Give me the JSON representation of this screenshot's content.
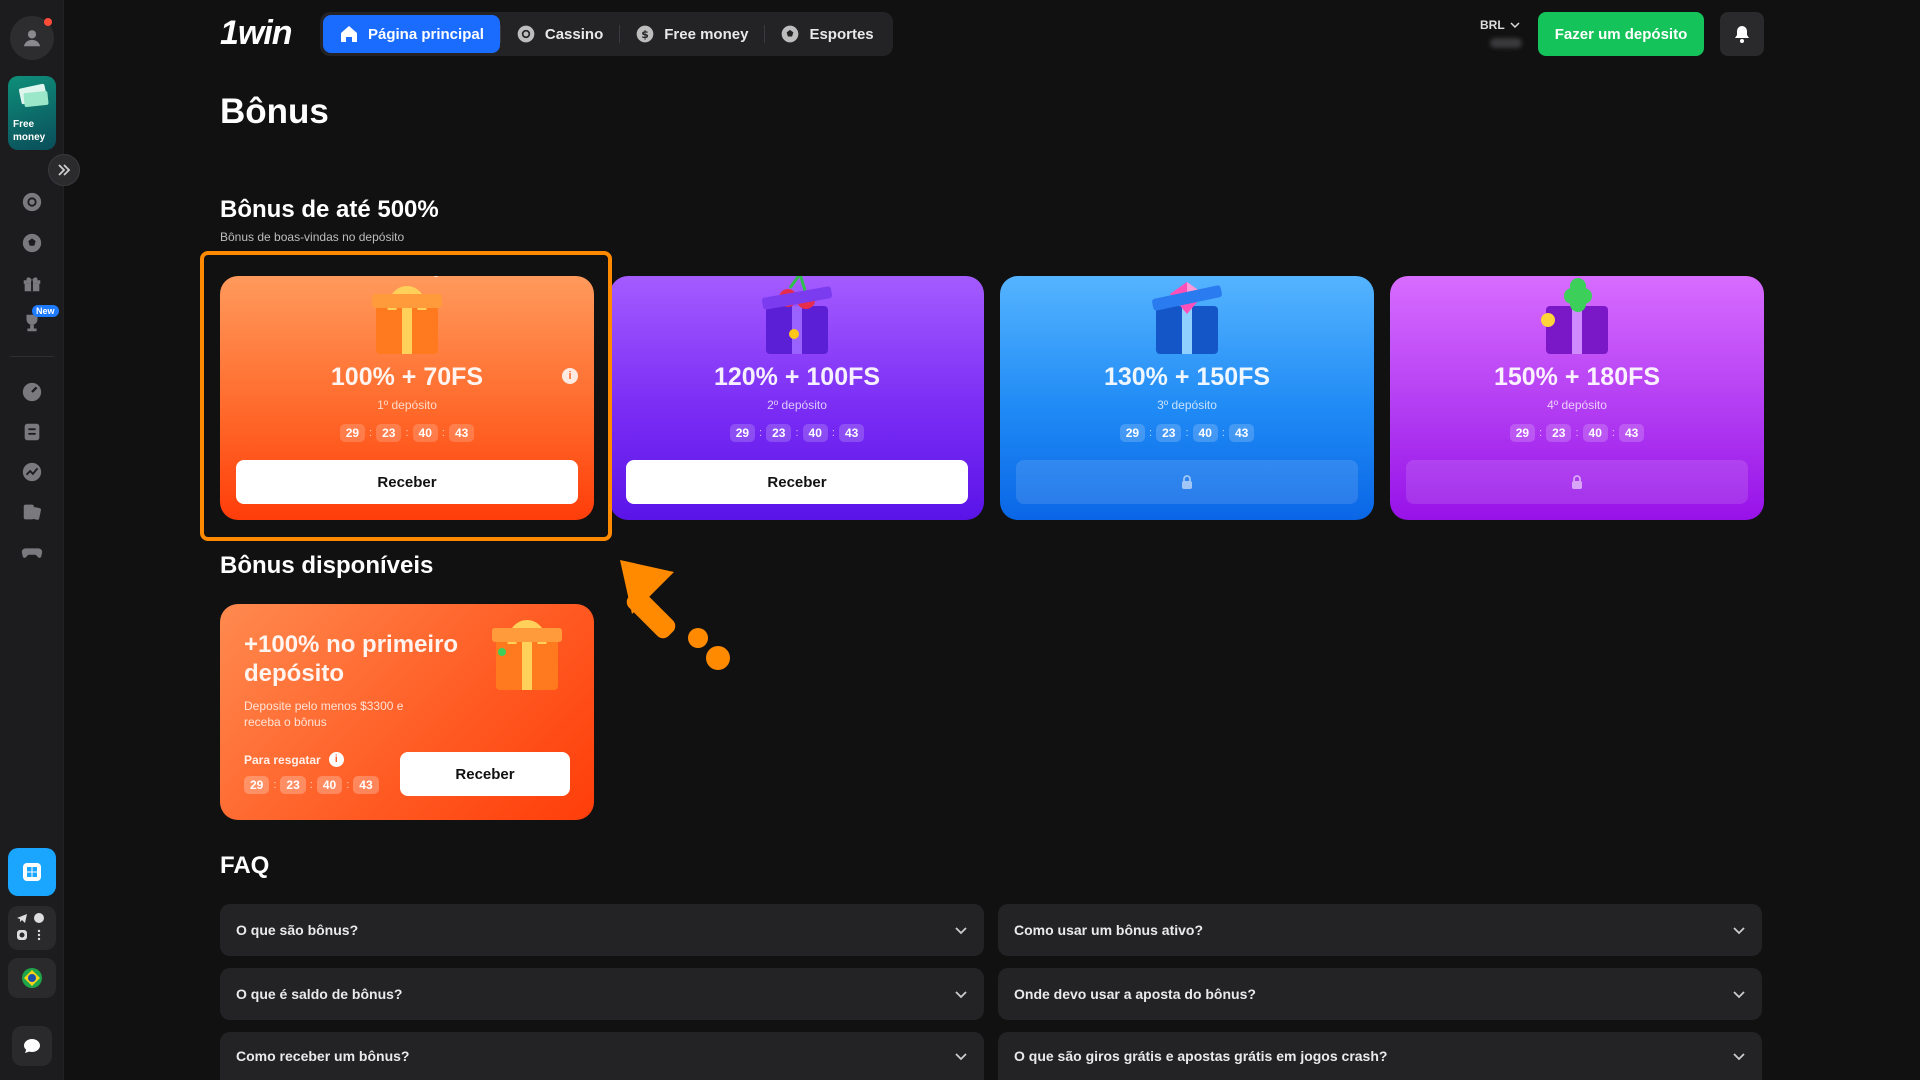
{
  "sidebar": {
    "free_money_label": "Free\nmoney",
    "new_badge": "New"
  },
  "header": {
    "logo": "1win",
    "nav": [
      {
        "label": "Página principal",
        "icon": "home-icon"
      },
      {
        "label": "Cassino",
        "icon": "casino-chip-icon"
      },
      {
        "label": "Free money",
        "icon": "dollar-coin-icon"
      },
      {
        "label": "Esportes",
        "icon": "soccer-ball-icon"
      }
    ],
    "currency": "BRL",
    "deposit_button": "Fazer um depósito"
  },
  "page": {
    "title": "Bônus"
  },
  "welcome": {
    "title": "Bônus de até 500%",
    "subtitle": "Bônus de boas-vindas no depósito",
    "cards": [
      {
        "amount": "100% + 70FS",
        "deposit": "1º depósito",
        "timer": [
          "29",
          "23",
          "40",
          "43"
        ],
        "button": "Receber",
        "locked": false,
        "color": "#ff6a2b"
      },
      {
        "amount": "120% + 100FS",
        "deposit": "2º depósito",
        "timer": [
          "29",
          "23",
          "40",
          "43"
        ],
        "button": "Receber",
        "locked": false,
        "color": "#7a2cf4"
      },
      {
        "amount": "130% + 150FS",
        "deposit": "3º depósito",
        "timer": [
          "29",
          "23",
          "40",
          "43"
        ],
        "button": "",
        "locked": true,
        "color": "#1f8af5"
      },
      {
        "amount": "150% + 180FS",
        "deposit": "4º depósito",
        "timer": [
          "29",
          "23",
          "40",
          "43"
        ],
        "button": "",
        "locked": true,
        "color": "#b23cf2"
      }
    ]
  },
  "available": {
    "title": "Bônus disponíveis",
    "card": {
      "title": "+100% no primeiro depósito",
      "desc": "Deposite pelo menos $3300 e receba o bônus",
      "redeem_label": "Para resgatar",
      "timer": [
        "29",
        "23",
        "40",
        "43"
      ],
      "button": "Receber"
    }
  },
  "faq": {
    "title": "FAQ",
    "items": [
      "O que são bônus?",
      "Como usar um bônus ativo?",
      "O que é saldo de bônus?",
      "Onde devo usar a aposta do bônus?",
      "Como receber um bônus?",
      "O que são giros grátis e apostas grátis em jogos crash?"
    ]
  }
}
